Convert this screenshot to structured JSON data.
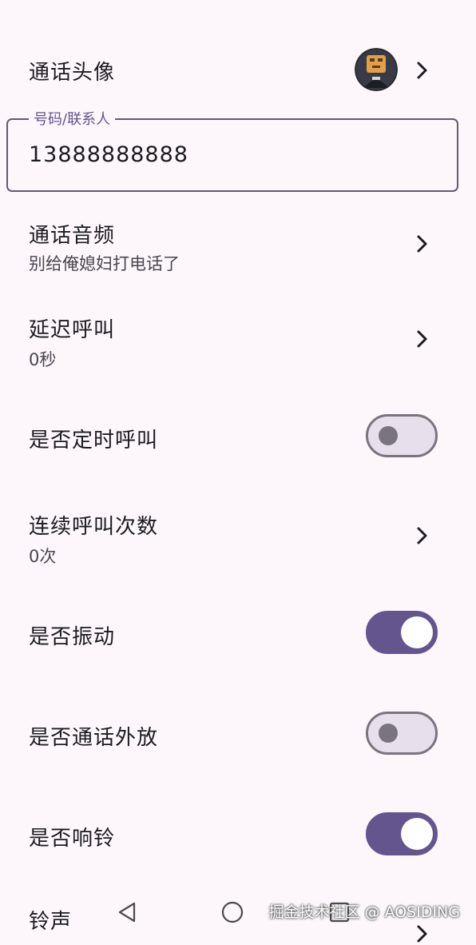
{
  "settings": {
    "avatar": {
      "label": "通话头像"
    },
    "phone_field": {
      "label": "号码/联系人",
      "value": "13888888888"
    },
    "audio": {
      "label": "通话音频",
      "value": "别给俺媳妇打电话了"
    },
    "delay": {
      "label": "延迟呼叫",
      "value": "0秒"
    },
    "scheduled": {
      "label": "是否定时呼叫",
      "checked": false
    },
    "repeat": {
      "label": "连续呼叫次数",
      "value": "0次"
    },
    "vibrate": {
      "label": "是否振动",
      "checked": true
    },
    "speaker": {
      "label": "是否通话外放",
      "checked": false
    },
    "ring": {
      "label": "是否响铃",
      "checked": true
    },
    "ringtone": {
      "label": "铃声"
    }
  },
  "colors": {
    "accent": "#65558f",
    "background": "#fdf7fb",
    "switch_off_track": "#e7e0ec",
    "switch_outline": "#79747e"
  },
  "navbar": {
    "back_icon": "triangle-back-icon",
    "home_icon": "circle-home-icon",
    "recents_icon": "square-recents-icon"
  },
  "watermark": "掘金技术社区 @ AOSIDING"
}
